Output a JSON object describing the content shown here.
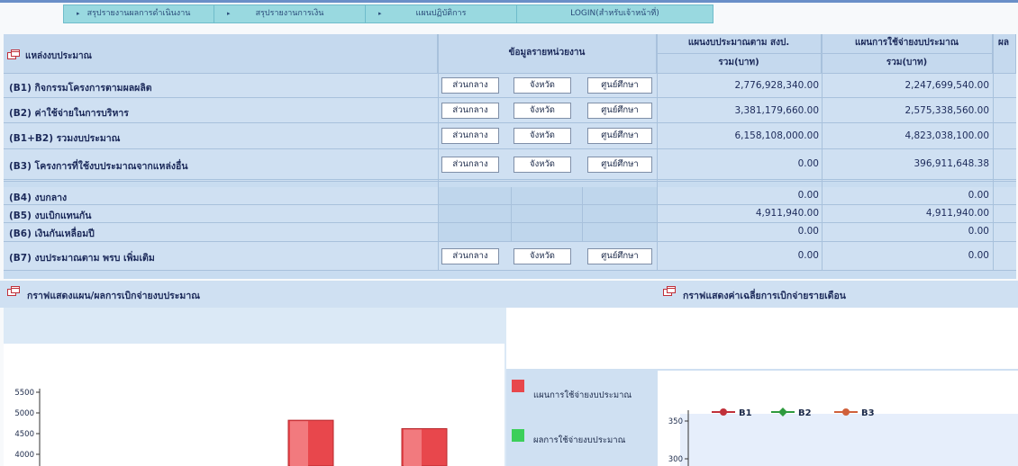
{
  "nav": {
    "items": [
      {
        "label": "สรุปรายงานผลการดำเนินงาน",
        "arrow": "▸"
      },
      {
        "label": "สรุปรายงานการเงิน",
        "arrow": "▸"
      },
      {
        "label": "แผนปฏิบัติการ",
        "arrow": "▸"
      },
      {
        "label": "LOGIN(สำหรับเจ้าหน้าที่)",
        "arrow": ""
      }
    ]
  },
  "table": {
    "source_header": "แหล่งงบประมาณ",
    "unit_header": "ข้อมูลรายหน่วยงาน",
    "plan_header": "แผนงบประมาณตาม สงป.",
    "plan_sub": "รวม(บาท)",
    "spend_header": "แผนการใช้จ่ายงบประมาณ",
    "spend_sub": "รวม(บาท)",
    "extra_header": "ผล",
    "buttons": {
      "central": "ส่วนกลาง",
      "province": "จังหวัด",
      "center": "ศูนย์ศึกษา"
    },
    "rows": [
      {
        "label": "(B1) กิจกรรมโครงการตามผลผลิต",
        "plan": "2,776,928,340.00",
        "spend": "2,247,699,540.00"
      },
      {
        "label": "(B2) ค่าใช้จ่ายในการบริหาร",
        "plan": "3,381,179,660.00",
        "spend": "2,575,338,560.00"
      },
      {
        "label": "(B1+B2) รวมงบประมาณ",
        "plan": "6,158,108,000.00",
        "spend": "4,823,038,100.00"
      },
      {
        "label": "(B3) โครงการที่ใช้งบประมาณจากแหล่งอื่น",
        "plan": "0.00",
        "spend": "396,911,648.38"
      },
      {
        "label": "(B4) งบกลาง",
        "plan": "0.00",
        "spend": "0.00"
      },
      {
        "label": "(B5) งบเบิกแทนกัน",
        "plan": "4,911,940.00",
        "spend": "4,911,940.00"
      },
      {
        "label": "(B6) เงินกันเหลื่อมปี",
        "plan": "0.00",
        "spend": "0.00"
      },
      {
        "label": "(B7) งบประมาณตาม พรบ เพิ่มเติม",
        "plan": "0.00",
        "spend": "0.00"
      }
    ]
  },
  "sections": {
    "left_title": "กราฟแสดงแผน/ผลการเบิกจ่ายงบประมาณ",
    "right_title": "กราฟแสดงค่าเฉลี่ยการเบิกจ่ายรายเดือน"
  },
  "left_chart": {
    "legend": [
      "แผนการใช้จ่ายงบประมาณ",
      "ผลการใช้จ่ายงบประมาณ"
    ],
    "legend_colors": [
      "#e8474c",
      "#3ccf5a"
    ],
    "y_ticks": [
      "5500",
      "5000",
      "4500",
      "4000"
    ],
    "bars": [
      4823,
      4620
    ]
  },
  "right_chart": {
    "series": [
      {
        "name": "B1",
        "color": "#c0303a",
        "marker": "circle"
      },
      {
        "name": "B2",
        "color": "#2e9a3e",
        "marker": "diamond"
      },
      {
        "name": "B3",
        "color": "#d0603a",
        "marker": "circle-x"
      }
    ],
    "y_ticks": [
      "350",
      "300"
    ]
  },
  "icons": {
    "table_icon": "window-icon"
  }
}
